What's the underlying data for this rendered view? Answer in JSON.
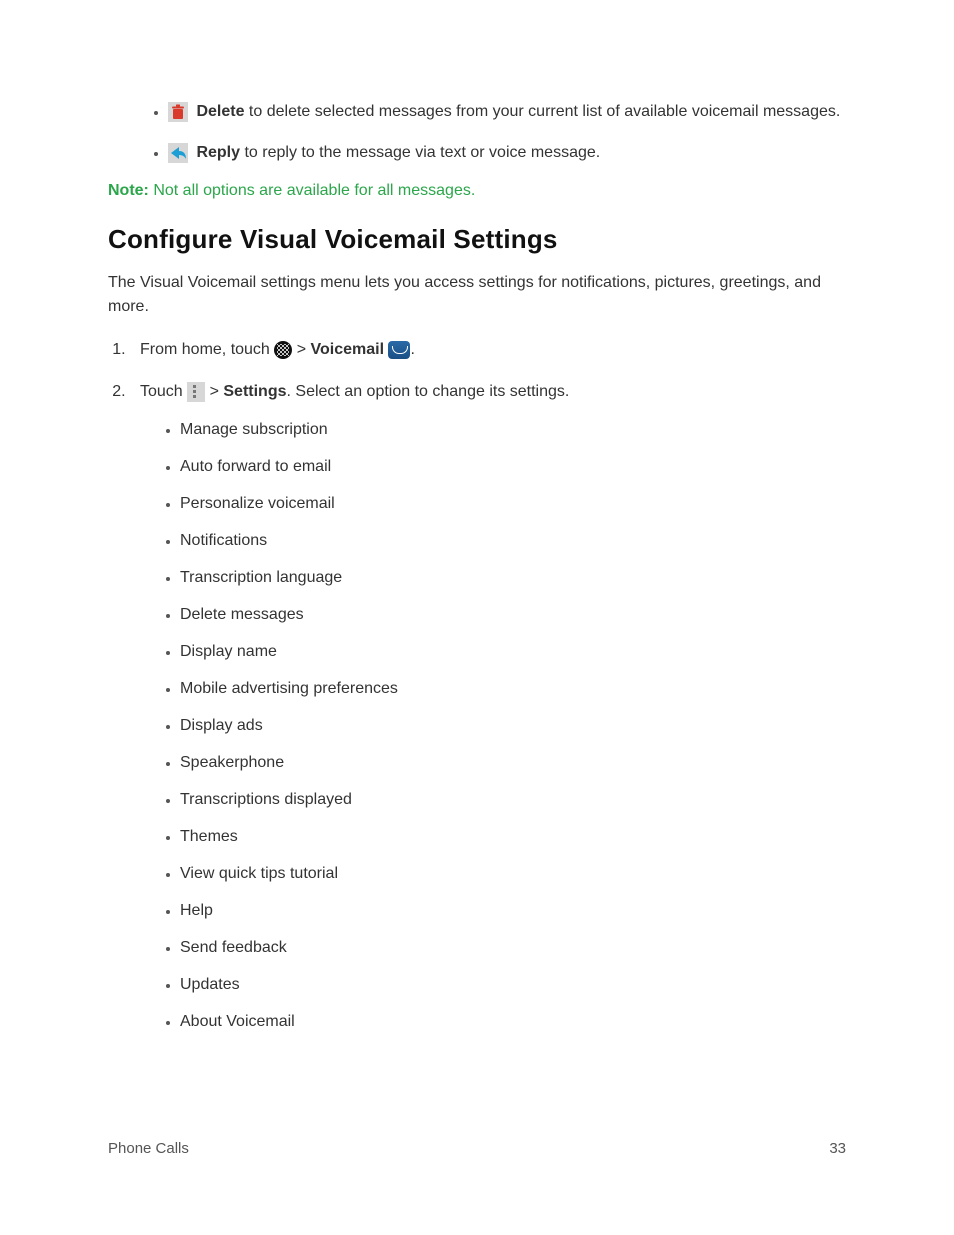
{
  "top_actions": {
    "delete": {
      "label": "Delete",
      "text": " to delete selected messages from your current list of available voicemail messages."
    },
    "reply": {
      "label": "Reply",
      "text": " to reply to the message via text or voice message."
    }
  },
  "note": {
    "label": "Note:",
    "text": " Not all options are available for all messages."
  },
  "section": {
    "title": "Configure Visual Voicemail Settings",
    "intro": "The Visual Voicemail settings menu lets you access settings for notifications, pictures, greetings, and more."
  },
  "steps": {
    "s1": {
      "prefix": "From home, touch ",
      "sep": " > ",
      "vm_label": "Voicemail",
      "suffix": "."
    },
    "s2": {
      "prefix": "Touch ",
      "sep": " > ",
      "settings_label": "Settings",
      "suffix": ". Select an option to change its settings."
    }
  },
  "options": [
    "Manage subscription",
    "Auto forward to email",
    "Personalize voicemail",
    "Notifications",
    "Transcription language",
    "Delete messages",
    "Display name",
    "Mobile advertising preferences",
    "Display ads",
    "Speakerphone",
    "Transcriptions displayed",
    "Themes",
    "View quick tips tutorial",
    "Help",
    "Send feedback",
    "Updates",
    "About Voicemail"
  ],
  "footer": {
    "section": "Phone Calls",
    "page": "33"
  }
}
